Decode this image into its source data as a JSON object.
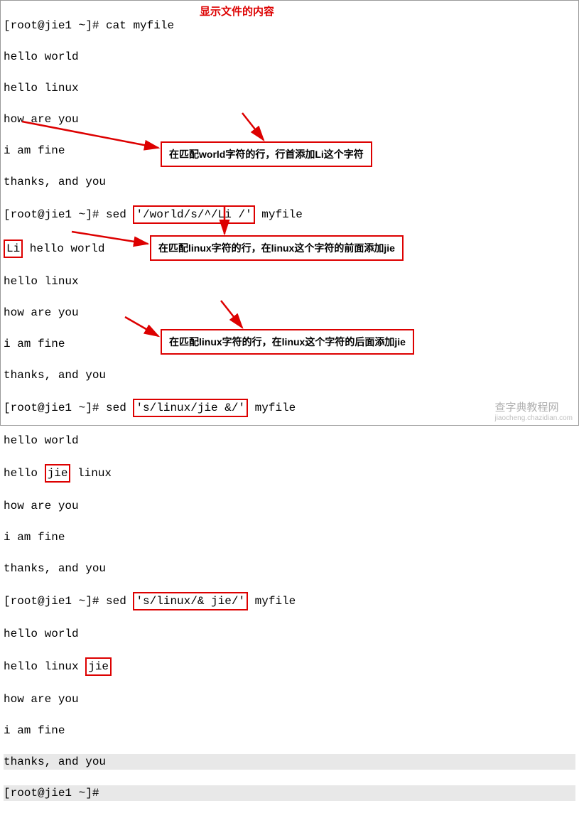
{
  "prompt": "[root@jie1 ~]#",
  "cmds": {
    "cat": "cat myfile",
    "sed1": "sed ",
    "sed1_arg": "'/world/s/^/Li /'",
    "sed1_file": " myfile",
    "sed2": "sed ",
    "sed2_arg": "'s/linux/jie &/'",
    "sed2_file": " myfile",
    "sed3": "sed ",
    "sed3_arg": "'s/linux/& jie/'",
    "sed3_file": " myfile"
  },
  "out": {
    "l1": "hello world",
    "l2": "hello linux",
    "l3": "how are you",
    "l4": "i am fine",
    "l5": "thanks, and you",
    "r1_li": "Li",
    "r1_rest": " hello world",
    "r2_pre": "hello ",
    "r2_jie": "jie",
    "r2_post": " linux",
    "r3_pre": "hello linux ",
    "r3_jie": "jie"
  },
  "annot": {
    "title": "显示文件的内容",
    "a1": "在匹配world字符的行，行首添加Li这个字符",
    "a2": "在匹配linux字符的行，在linux这个字符的前面添加jie",
    "a3": "在匹配linux字符的行，在linux这个字符的后面添加jie"
  },
  "watermark": {
    "main": "查字典教程网",
    "sub": "jiaocheng.chazidian.com"
  }
}
